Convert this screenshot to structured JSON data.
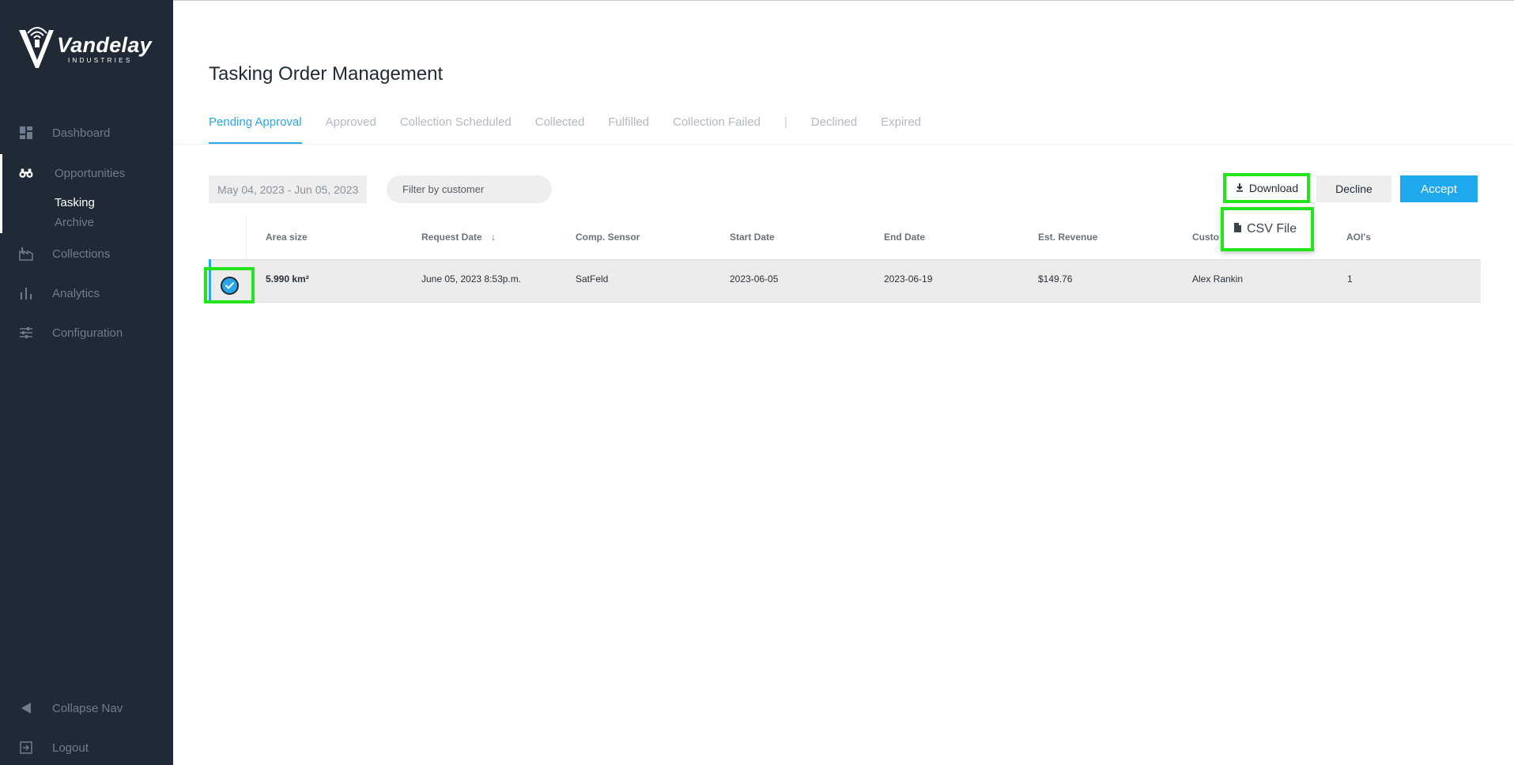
{
  "brand": {
    "name": "Vandelay",
    "tagline": "INDUSTRIES"
  },
  "sidebar": {
    "items": [
      {
        "label": "Dashboard",
        "icon": "dashboard-icon"
      },
      {
        "label": "Opportunities",
        "icon": "binoculars-icon"
      },
      {
        "label": "Collections",
        "icon": "factory-icon"
      },
      {
        "label": "Analytics",
        "icon": "bar-chart-icon"
      },
      {
        "label": "Configuration",
        "icon": "sliders-icon"
      }
    ],
    "subitems": [
      {
        "label": "Tasking",
        "active": true
      },
      {
        "label": "Archive",
        "active": false
      }
    ],
    "collapse_label": "Collapse Nav",
    "logout_label": "Logout"
  },
  "page": {
    "title": "Tasking Order Management"
  },
  "tabs": [
    {
      "label": "Pending Approval",
      "active": true
    },
    {
      "label": "Approved"
    },
    {
      "label": "Collection Scheduled"
    },
    {
      "label": "Collected"
    },
    {
      "label": "Fulfilled"
    },
    {
      "label": "Collection Failed"
    },
    {
      "label": "Declined"
    },
    {
      "label": "Expired"
    }
  ],
  "toolbar": {
    "date_range": "May 04, 2023  -  Jun 05, 2023",
    "filter_placeholder": "Filter by customer",
    "download_label": "Download",
    "decline_label": "Decline",
    "accept_label": "Accept",
    "dropdown_item": "CSV File"
  },
  "table": {
    "headers": [
      "Area size",
      "Request Date",
      "Comp. Sensor",
      "Start Date",
      "End Date",
      "Est. Revenue",
      "Custo",
      "AOI's"
    ],
    "rows": [
      [
        "5.990 km²",
        "June 05, 2023 8:53p.m.",
        "SatFeld",
        "2023-06-05",
        "2023-06-19",
        "$149.76",
        "Alex Rankin",
        "1"
      ]
    ]
  },
  "colors": {
    "sidebar_bg": "#1f2a36",
    "accent": "#2aa7e8",
    "accept": "#1ea9ee",
    "highlight": "#22e51b"
  }
}
